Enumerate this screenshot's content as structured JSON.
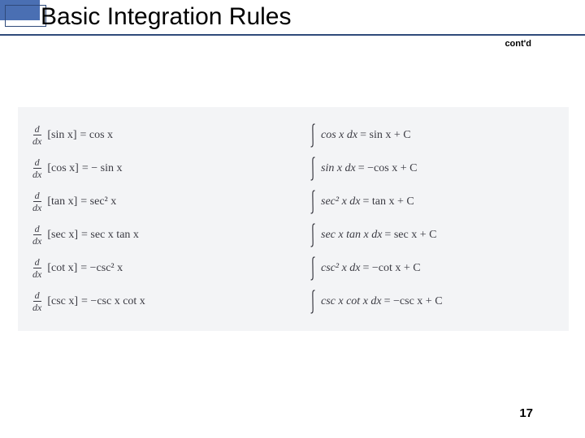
{
  "header": {
    "title": "Basic Integration Rules",
    "contd": "cont'd"
  },
  "frac": {
    "num": "d",
    "den": "dx"
  },
  "rows": [
    {
      "d_of": "[sin x]",
      "d_eq": "= cos x",
      "int_of": "cos x dx",
      "int_eq": "= sin x + C"
    },
    {
      "d_of": "[cos x]",
      "d_eq": "= − sin x",
      "int_of": "sin x dx",
      "int_eq": "= −cos x + C"
    },
    {
      "d_of": "[tan x]",
      "d_eq": "= sec² x",
      "int_of": "sec² x dx",
      "int_eq": "= tan x + C"
    },
    {
      "d_of": "[sec x]",
      "d_eq": "= sec x tan x",
      "int_of": "sec x tan x dx",
      "int_eq": "= sec x + C"
    },
    {
      "d_of": "[cot x]",
      "d_eq": "= −csc² x",
      "int_of": "csc² x dx",
      "int_eq": "= −cot x + C"
    },
    {
      "d_of": "[csc x]",
      "d_eq": "= −csc x cot x",
      "int_of": "csc x cot x dx",
      "int_eq": "= −csc x + C"
    }
  ],
  "pagenum": "17"
}
